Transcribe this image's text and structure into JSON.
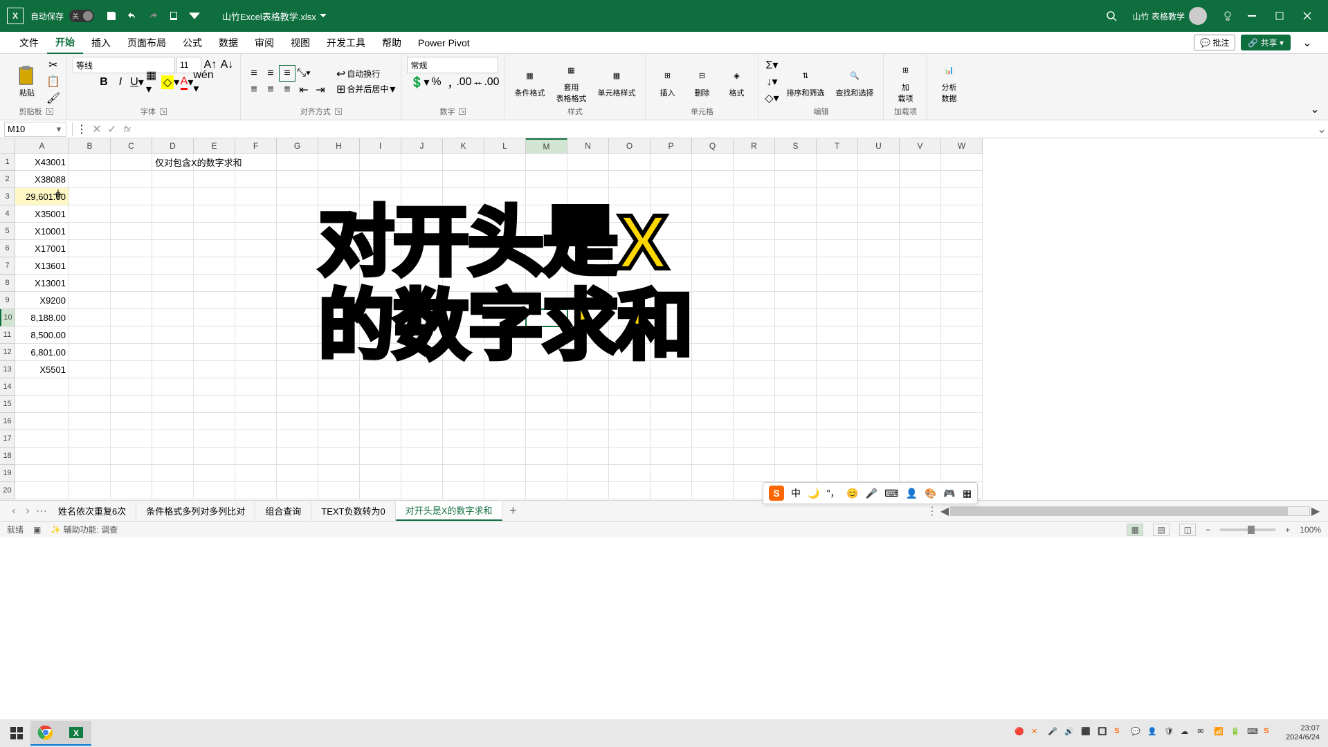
{
  "titlebar": {
    "autosave_label": "自动保存",
    "autosave_state": "关",
    "filename": "山竹Excel表格教学.xlsx",
    "username": "山竹 表格教学"
  },
  "tabs": {
    "file": "文件",
    "home": "开始",
    "insert": "插入",
    "layout": "页面布局",
    "formula": "公式",
    "data": "数据",
    "review": "审阅",
    "view": "视图",
    "dev": "开发工具",
    "help": "帮助",
    "pivot": "Power Pivot",
    "comments": "批注",
    "share": "共享"
  },
  "ribbon": {
    "paste": "粘贴",
    "clipboard": "剪贴板",
    "font_name": "等线",
    "font_size": "11",
    "font_group": "字体",
    "wrap": "自动换行",
    "merge": "合并后居中",
    "align_group": "对齐方式",
    "number_format": "常规",
    "number_group": "数字",
    "cond_fmt": "条件格式",
    "table_fmt": "套用\n表格格式",
    "cell_style": "单元格样式",
    "style_group": "样式",
    "insert": "插入",
    "delete": "删除",
    "format": "格式",
    "cells_group": "单元格",
    "sort": "排序和筛选",
    "find": "查找和选择",
    "edit_group": "编辑",
    "addins": "加\n载项",
    "addins_group": "加载项",
    "analyze": "分析\n数据"
  },
  "formula_bar": {
    "name_box": "M10",
    "fx": "fx"
  },
  "columns": [
    "A",
    "B",
    "C",
    "D",
    "E",
    "F",
    "G",
    "H",
    "I",
    "J",
    "K",
    "L",
    "M",
    "N",
    "O",
    "P",
    "Q",
    "R",
    "S",
    "T",
    "U",
    "V",
    "W"
  ],
  "rows": [
    1,
    2,
    3,
    4,
    5,
    6,
    7,
    8,
    9,
    10,
    11,
    12,
    13,
    14,
    15,
    16,
    17,
    18,
    19,
    20
  ],
  "col_A": [
    "X43001",
    "X38088",
    "29,601.00",
    "X35001",
    "X10001",
    "X17001",
    "X13601",
    "X13001",
    "X9200",
    "8,188.00",
    "8,500.00",
    "6,801.00",
    "X5501"
  ],
  "d1_text": "仅对包含X的数字求和",
  "overlay": {
    "line1": "对开头是X",
    "line2": "的数字求和"
  },
  "sheet_tabs": {
    "t1": "姓名依次重复6次",
    "t2": "条件格式多列对多列比对",
    "t3": "组合查询",
    "t4": "TEXT负数转为0",
    "t5": "对开头是X的数字求和"
  },
  "status": {
    "ready": "就绪",
    "access": "辅助功能: 调查",
    "zoom": "100%"
  },
  "ime": {
    "ch": "中"
  },
  "clock": {
    "time": "23:07",
    "date": "2024/6/24"
  },
  "selected_cell": "M10",
  "highlighted_cell": "A3"
}
